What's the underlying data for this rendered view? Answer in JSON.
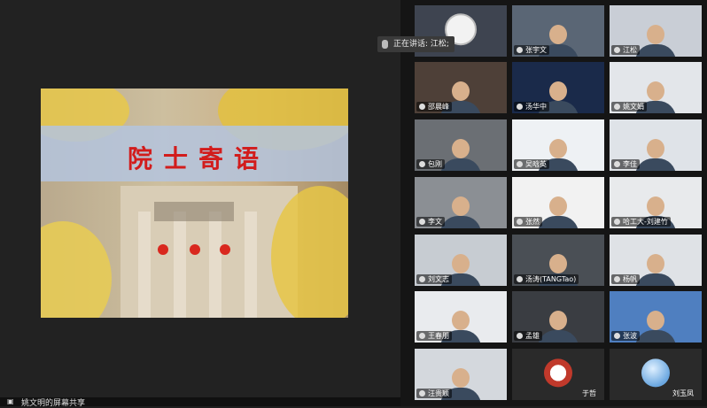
{
  "slide": {
    "title": "院士寄语"
  },
  "screen_share_label": "姚文明的屏幕共享",
  "speaker_popup": "正在讲话: 江松;",
  "tiles": [
    {
      "name": "",
      "variant": "avatar-panda"
    },
    {
      "name": "张宇文"
    },
    {
      "name": "江松"
    },
    {
      "name": "邵晨峰"
    },
    {
      "name": "汤华中"
    },
    {
      "name": "姚文娟"
    },
    {
      "name": "包刚"
    },
    {
      "name": "吴晗英"
    },
    {
      "name": "李佳"
    },
    {
      "name": "李文"
    },
    {
      "name": "张然"
    },
    {
      "name": "哈工大-刘建竹"
    },
    {
      "name": "刘文志"
    },
    {
      "name": "汤涛(TANGTao)"
    },
    {
      "name": "杨帆"
    },
    {
      "name": "王春朋"
    },
    {
      "name": "孟雄"
    },
    {
      "name": "张波"
    },
    {
      "name": "汪贵颖"
    },
    {
      "name": "于哲",
      "variant": "avatar-logo"
    },
    {
      "name": "刘玉凤",
      "variant": "avatar-globe"
    }
  ]
}
